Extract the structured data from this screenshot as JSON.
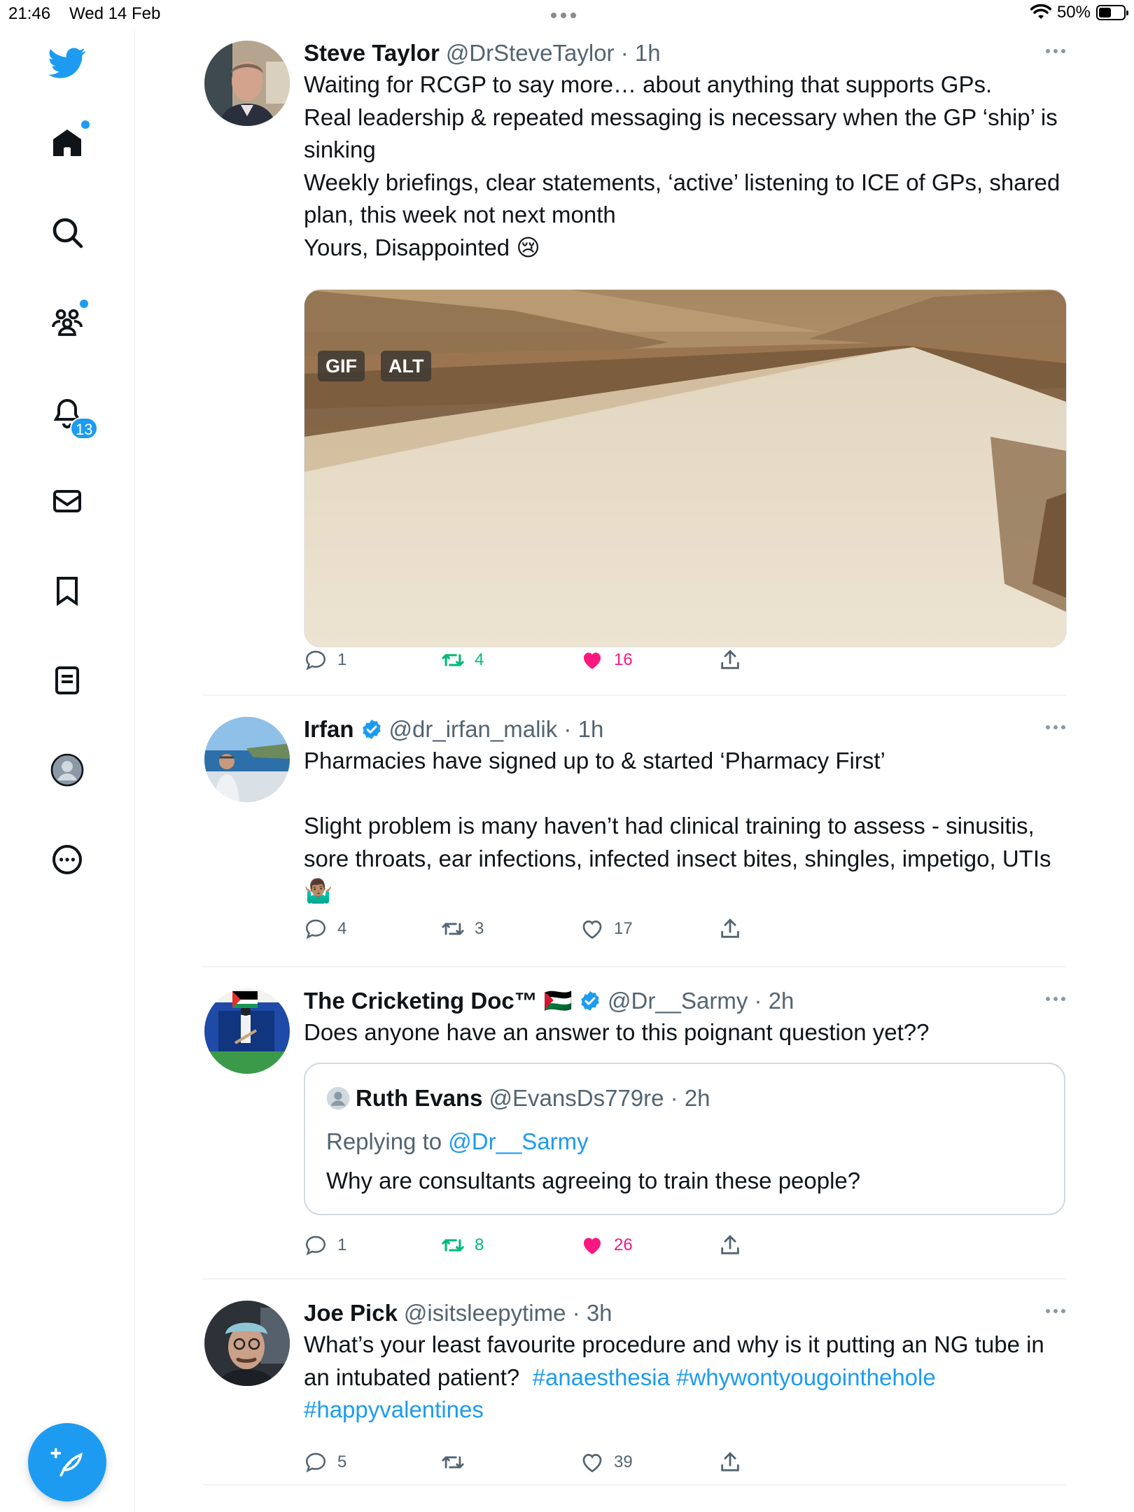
{
  "status_bar": {
    "time": "21:46",
    "date": "Wed 14 Feb",
    "battery": "50%",
    "battery_level": 0.5
  },
  "sidebar": {
    "items": [
      {
        "name": "home",
        "icon": "home-icon",
        "has_dot": true
      },
      {
        "name": "explore",
        "icon": "search-icon"
      },
      {
        "name": "communities",
        "icon": "communities-icon",
        "has_dot": true
      },
      {
        "name": "notifications",
        "icon": "bell-icon",
        "badge": "13"
      },
      {
        "name": "messages",
        "icon": "mail-icon"
      },
      {
        "name": "bookmarks",
        "icon": "bookmark-icon"
      },
      {
        "name": "lists",
        "icon": "list-icon"
      },
      {
        "name": "profile",
        "icon": "profile-icon"
      },
      {
        "name": "more",
        "icon": "more-circle-icon"
      }
    ],
    "compose_icon": "compose-feather-icon"
  },
  "tweets": [
    {
      "name": "Steve Taylor",
      "handle": "@DrSteveTaylor",
      "time": "1h",
      "text": "Waiting for RCGP to say more… about anything that supports GPs.\nReal leadership & repeated messaging is necessary when the GP ‘ship’ is sinking\nWeekly briefings, clear statements, ‘active’ listening to ICE of GPs, shared plan, this week not next month\nYours, Disappointed 😢",
      "media_tags": [
        "GIF",
        "ALT"
      ],
      "replies": "1",
      "retweets": "4",
      "likes": "16",
      "retweeted": true,
      "liked": true
    },
    {
      "name": "Irfan",
      "handle": "@dr_irfan_malik",
      "time": "1h",
      "verified": true,
      "text": "Pharmacies have signed up to & started ‘Pharmacy First’\n\nSlight problem is many haven’t had clinical training to assess - sinusitis, sore throats, ear infections, infected insect bites, shingles, impetigo, UTIs 🤷🏽‍♂️",
      "replies": "4",
      "retweets": "3",
      "likes": "17",
      "retweeted": false,
      "liked": false
    },
    {
      "name": "The Cricketing Doc™ 🇵🇸",
      "handle": "@Dr__Sarmy",
      "time": "2h",
      "verified": true,
      "text": "Does anyone have an answer to this poignant question yet??",
      "quote": {
        "name": "Ruth Evans",
        "handle": "@EvansDs779re",
        "time": "2h",
        "replying_label": "Replying to",
        "replying_to": "@Dr__Sarmy",
        "text": "Why are consultants agreeing to train these people?"
      },
      "replies": "1",
      "retweets": "8",
      "likes": "26",
      "retweeted": true,
      "liked": true
    },
    {
      "name": "Joe Pick",
      "handle": "@isitsleepytime",
      "time": "3h",
      "text": "What’s your least favourite procedure and why is it putting an NG tube in an intubated patient?",
      "hashtags": [
        "#anaesthesia",
        "#whywontyougointhehole",
        "#happyvalentines"
      ],
      "replies": "5",
      "retweets": "",
      "likes": "39",
      "retweeted": false,
      "liked": false
    }
  ],
  "colors": {
    "accent": "#1d9bf0",
    "retweet": "#00ba7c",
    "like": "#f91880",
    "secondary_text": "#536471"
  }
}
